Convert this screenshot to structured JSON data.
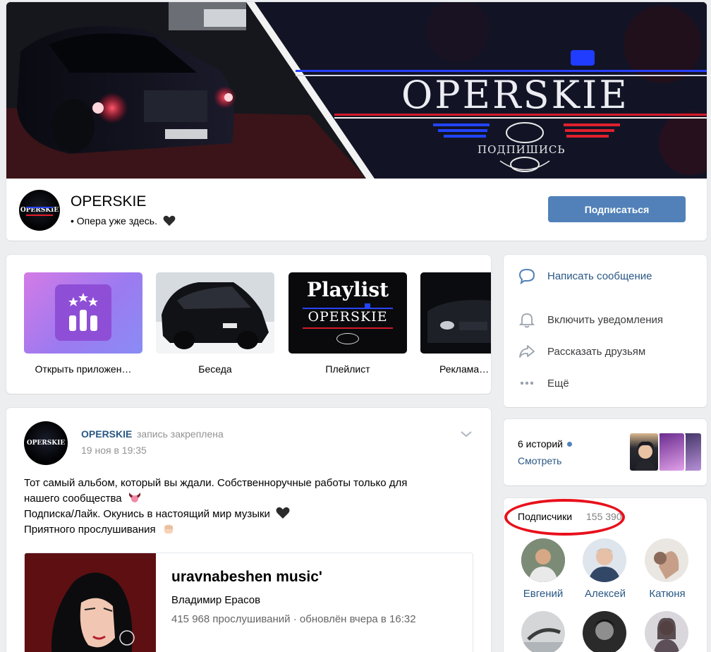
{
  "header": {
    "cover_title": "OPERSKIE",
    "cover_subtitle": "ПОДПИШИСЬ",
    "avatar_text": "OPERSKIE",
    "group_name": "OPERSKIE",
    "status": "• Опера уже здесь.",
    "subscribe_label": "Подписаться"
  },
  "shortcuts": {
    "items": [
      {
        "label": "Открыть приложен…",
        "icon": "app-rating-icon"
      },
      {
        "label": "Беседа",
        "icon": "car-photo"
      },
      {
        "label": "Плейлист",
        "icon": "playlist-cover",
        "cover_title": "Playlist",
        "cover_sub": "OPERSKIE"
      },
      {
        "label": "Реклама - …",
        "icon": "car-night-photo"
      }
    ]
  },
  "post": {
    "author": "OPERSKIE",
    "pinned_text": "запись закреплена",
    "date": "19 ноя в 19:35",
    "lines": [
      "Тот самый альбом, который вы ждали. Собственноручные работы только для",
      "нашего сообщества",
      "Подписка/Лайк. Окунись в настоящий мир музыки",
      "Приятного прослушивания"
    ],
    "attachment": {
      "title": "uravnabeshen music'",
      "artist": "Владимир Ерасов",
      "plays": "415 968 прослушиваний",
      "updated": "обновлён вчера в 16:32"
    }
  },
  "actions": {
    "message": "Написать сообщение",
    "notify": "Включить уведомления",
    "share": "Рассказать друзьям",
    "more": "Ещё"
  },
  "stories": {
    "count_label": "6 историй",
    "view_label": "Смотреть"
  },
  "subscribers": {
    "title": "Подписчики",
    "count": "155 390",
    "names": [
      "Евгений",
      "Алексей",
      "Катюня"
    ]
  },
  "colors": {
    "accent": "#5181b8",
    "link": "#2a5885",
    "background": "#edeef0",
    "highlight_oval": "#e8101b"
  }
}
